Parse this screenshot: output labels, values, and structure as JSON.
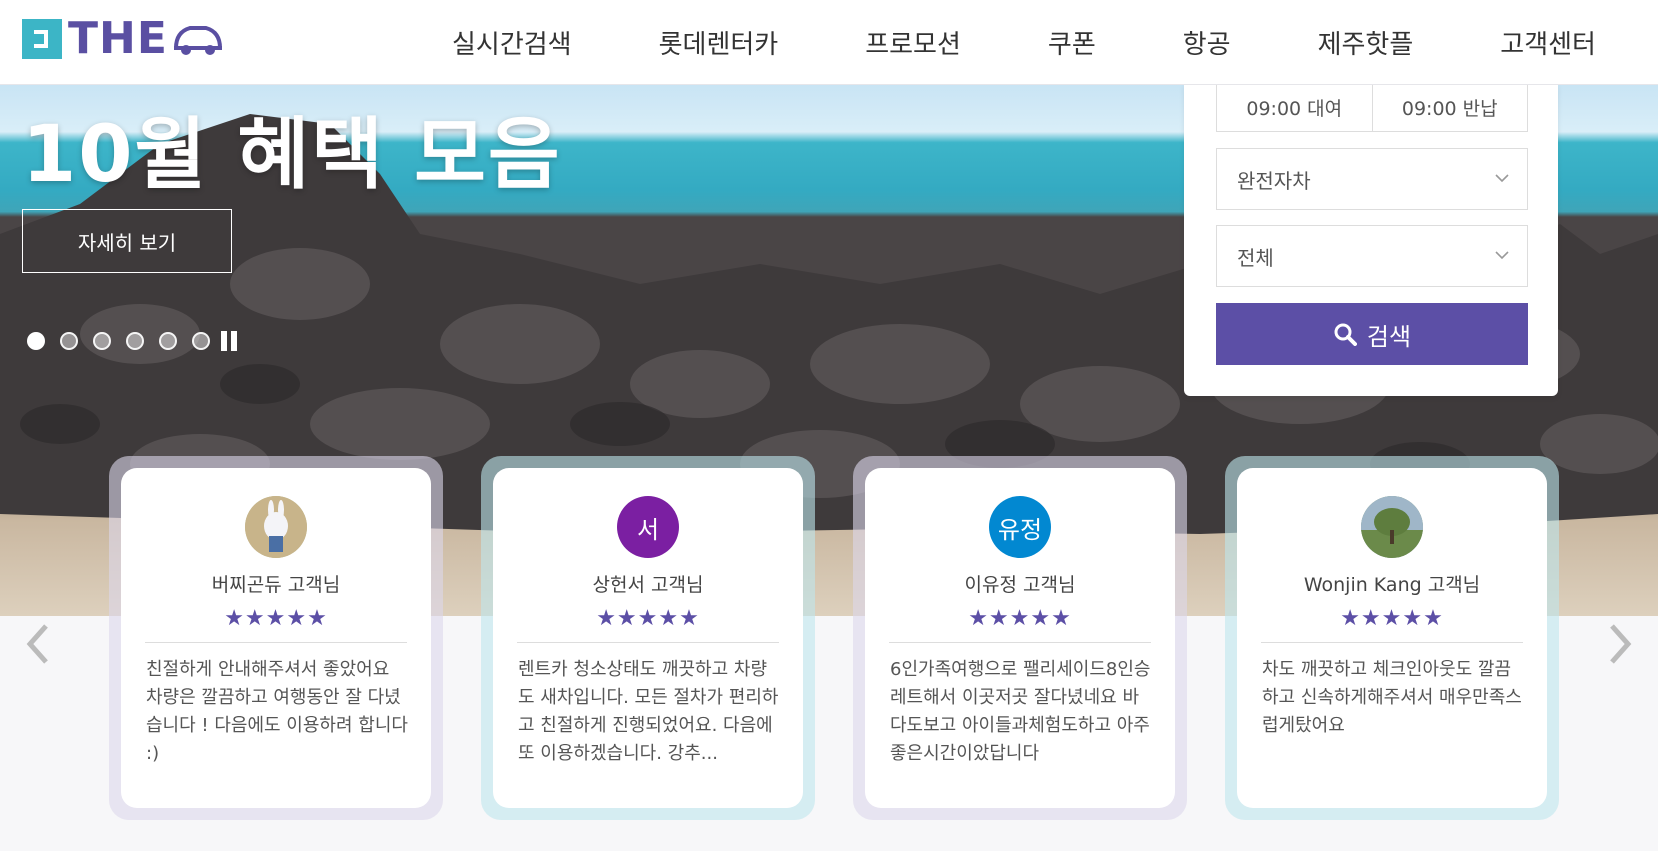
{
  "header": {
    "logo_text": "THE",
    "nav": [
      "실시간검색",
      "롯데렌터카",
      "프로모션",
      "쿠폰",
      "항공",
      "제주핫플",
      "고객센터"
    ]
  },
  "hero": {
    "title": "10월 혜택 모음",
    "more_label": "자세히 보기",
    "slides": 6,
    "active_slide": 1
  },
  "search": {
    "rent_time": "09:00 대여",
    "return_time": "09:00 반납",
    "insurance": "완전자차",
    "car_type": "전체",
    "button": "검색"
  },
  "reviews": [
    {
      "avatar_text": "",
      "avatar_color": "#b9c9a4",
      "name": "버찌곤듀 고객님",
      "stars": "★★★★★",
      "text": "친절하게 안내해주셔서 좋았어요 차량은 깔끔하고 여행동안 잘 다녔습니다 ! 다음에도 이용하려 합니다 :)"
    },
    {
      "avatar_text": "서",
      "avatar_color": "#7b1fa2",
      "name": "상헌서 고객님",
      "stars": "★★★★★",
      "text": "렌트카 청소상태도 깨끗하고 차량도 새차입니다. 모든 절차가 편리하고 친절하게 진행되었어요. 다음에 또 이용하겠습니다. 강추..."
    },
    {
      "avatar_text": "유정",
      "avatar_color": "#0288d1",
      "name": "이유정 고객님",
      "stars": "★★★★★",
      "text": "6인가족여행으로 팰리세이드8인승 레트해서 이곳저곳 잘다녔네요 바다도보고 아이들과체험도하고 아주좋은시간이았답니다"
    },
    {
      "avatar_text": "",
      "avatar_color": "#7a9a6a",
      "name": "Wonjin Kang 고객님",
      "stars": "★★★★★",
      "text": "차도 깨끗하고 체크인아웃도 깔끔하고 신속하게해주셔서 매우만족스럽게탔어요"
    }
  ],
  "colors": {
    "brand": "#5c4fa6",
    "teal": "#3cb5c6"
  }
}
